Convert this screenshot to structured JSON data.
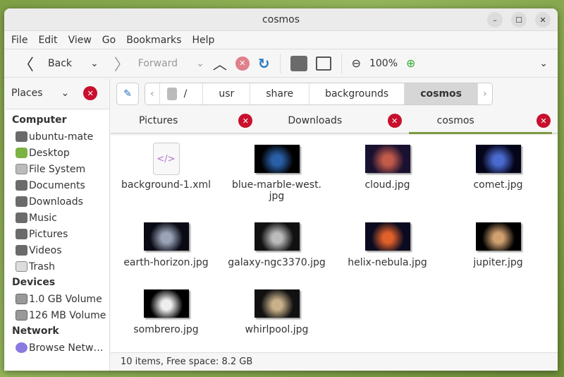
{
  "window": {
    "title": "cosmos"
  },
  "menu": [
    "File",
    "Edit",
    "View",
    "Go",
    "Bookmarks",
    "Help"
  ],
  "toolbar": {
    "back": "Back",
    "forward": "Forward",
    "zoom": "100%"
  },
  "sidebar": {
    "places_label": "Places",
    "sections": [
      {
        "title": "Computer",
        "items": [
          {
            "label": "ubuntu-mate",
            "icon": "folder"
          },
          {
            "label": "Desktop",
            "icon": "desktop"
          },
          {
            "label": "File System",
            "icon": "drive"
          },
          {
            "label": "Documents",
            "icon": "folder"
          },
          {
            "label": "Downloads",
            "icon": "folder"
          },
          {
            "label": "Music",
            "icon": "folder"
          },
          {
            "label": "Pictures",
            "icon": "folder"
          },
          {
            "label": "Videos",
            "icon": "folder"
          },
          {
            "label": "Trash",
            "icon": "trash"
          }
        ]
      },
      {
        "title": "Devices",
        "items": [
          {
            "label": "1.0 GB Volume",
            "icon": "disk"
          },
          {
            "label": "126 MB Volume",
            "icon": "disk"
          }
        ]
      },
      {
        "title": "Network",
        "items": [
          {
            "label": "Browse Netw…",
            "icon": "network"
          }
        ]
      }
    ]
  },
  "path": {
    "root": "/",
    "crumbs": [
      "usr",
      "share",
      "backgrounds",
      "cosmos"
    ]
  },
  "tabs": [
    {
      "label": "Pictures"
    },
    {
      "label": "Downloads"
    },
    {
      "label": "cosmos",
      "active": true
    }
  ],
  "files": [
    {
      "name": "background-1.xml",
      "kind": "xml"
    },
    {
      "name": "blue-marble-west.\njpg",
      "colors": [
        "#2a5fa8",
        "#000"
      ]
    },
    {
      "name": "cloud.jpg",
      "colors": [
        "#c25a4a",
        "#1a1030"
      ]
    },
    {
      "name": "comet.jpg",
      "colors": [
        "#4a6ad0",
        "#05051a"
      ]
    },
    {
      "name": "earth-horizon.jpg",
      "colors": [
        "#9aa4b8",
        "#0a0a15"
      ]
    },
    {
      "name": "galaxy-ngc3370.jpg",
      "colors": [
        "#bbbbbb",
        "#111"
      ]
    },
    {
      "name": "helix-nebula.jpg",
      "colors": [
        "#e0602a",
        "#0a0a20"
      ]
    },
    {
      "name": "jupiter.jpg",
      "colors": [
        "#d0a070",
        "#000"
      ]
    },
    {
      "name": "sombrero.jpg",
      "colors": [
        "#eeeeee",
        "#000"
      ]
    },
    {
      "name": "whirlpool.jpg",
      "colors": [
        "#c8b08a",
        "#111"
      ]
    }
  ],
  "status": "10 items, Free space: 8.2 GB"
}
